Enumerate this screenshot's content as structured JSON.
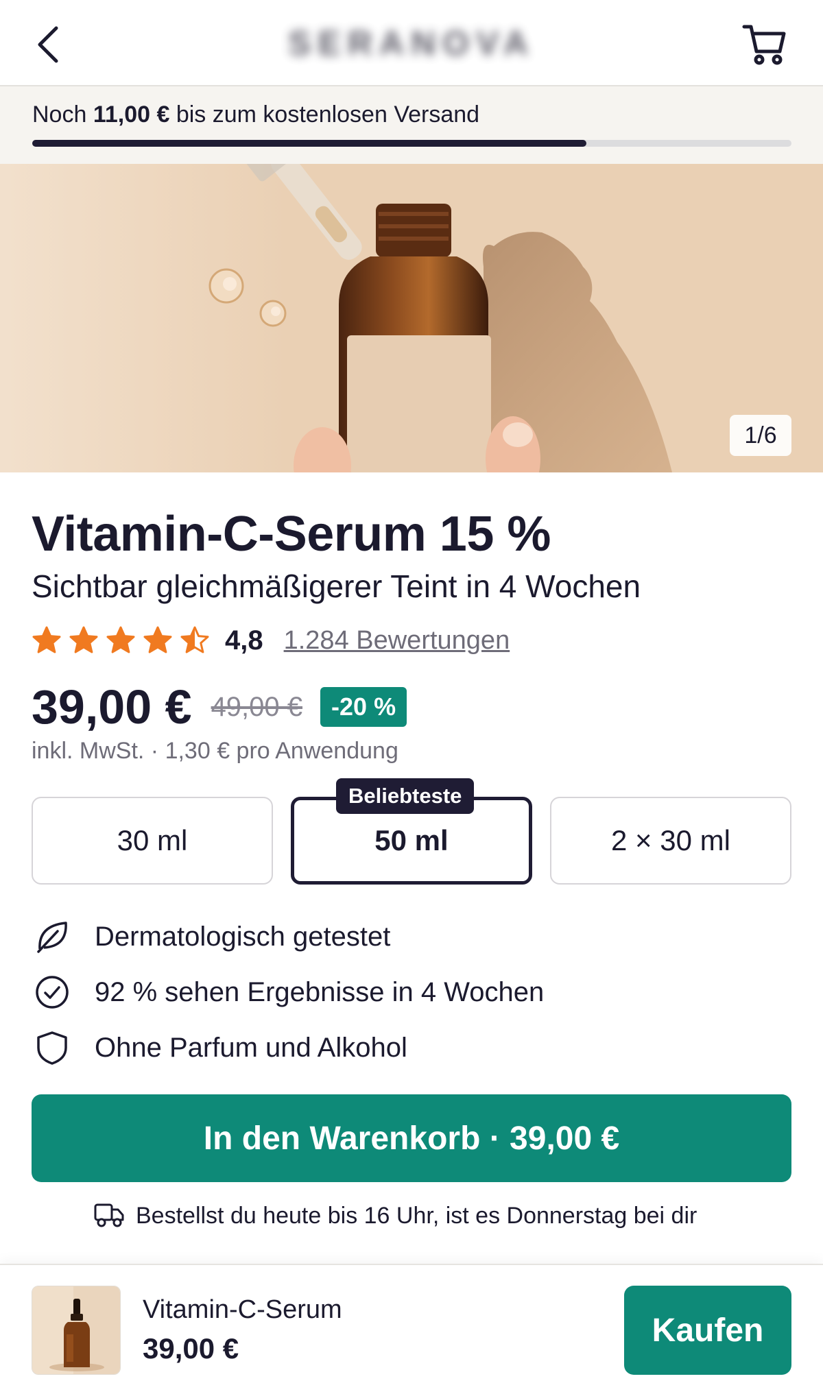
{
  "header": {
    "back_icon": "chevron-left-icon",
    "brand": "SERANOVA",
    "cart_icon": "shopping-cart-icon"
  },
  "shipping": {
    "prefix": "Noch ",
    "amount": "11,00 €",
    "suffix": " bis zum kostenlosen Versand",
    "progress_fraction": 0.73
  },
  "gallery": {
    "counter": "1/6"
  },
  "product": {
    "title": "Vitamin-C-Serum 15 %",
    "subtitle": "Sichtbar gleichmäßigerer Teint in 4 Wochen",
    "rating": "4,8",
    "rating_stars": 4.5,
    "reviews": "1.284 Bewertungen",
    "price": "39,00 €",
    "old_price": "49,00 €",
    "discount": "-20 %",
    "tax_note": "inkl. MwSt. · 1,30 € pro Anwendung"
  },
  "sizes": {
    "options": [
      "30 ml",
      "50 ml",
      "2 × 30 ml"
    ],
    "selected": "50 ml",
    "badge": "Beliebteste"
  },
  "features": [
    {
      "icon": "leaf-icon",
      "text": "Dermatologisch getestet"
    },
    {
      "icon": "check-circle-icon",
      "text": "92 % sehen Ergebnisse in 4 Wochen"
    },
    {
      "icon": "shield-icon",
      "text": "Ohne Parfum und Alkohol"
    }
  ],
  "cta": {
    "label": "In den Warenkorb · 39,00 €"
  },
  "delivery": {
    "icon": "truck-icon",
    "text": "Bestellst du heute bis 16 Uhr, ist es Donnerstag bei dir"
  },
  "sticky": {
    "name": "Vitamin-C-Serum",
    "price": "39,00 €",
    "button": "Kaufen"
  },
  "colors": {
    "accent": "#0e8a78",
    "dark": "#1f1c34",
    "star": "#f07a20"
  }
}
